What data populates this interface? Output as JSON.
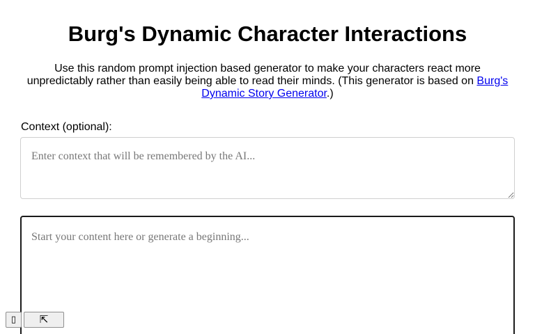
{
  "header": {
    "title": "Burg's Dynamic Character Interactions"
  },
  "intro": {
    "text_before": "Use this random prompt injection based generator to make your characters react more unpredictably rather than easily being able to read their minds. (This generator is based on ",
    "link_text": "Burg's Dynamic Story Generator",
    "text_after": ".)"
  },
  "context": {
    "label": "Context (optional):",
    "placeholder": "Enter context that will be remembered by the AI...",
    "value": ""
  },
  "editor": {
    "placeholder": "Start your content here or generate a beginning...",
    "value": ""
  },
  "controls": {
    "menu_button_label": "▯",
    "menu_icon": "box-icon",
    "collapse_button_label": "⇱",
    "collapse_icon": "arrow-up-left-icon"
  }
}
